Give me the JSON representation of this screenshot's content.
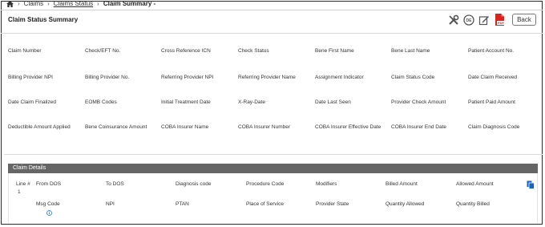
{
  "breadcrumb": {
    "items": [
      "Claims",
      "Claims Status"
    ],
    "current": "Claim Summary -"
  },
  "page": {
    "title": "Claim Status Summary",
    "back_label": "Back"
  },
  "toolbar": {
    "icons": [
      "tools-icon",
      "dde-icon",
      "edit-icon",
      "pdf-icon"
    ]
  },
  "summary_fields": [
    [
      "Claim Number",
      "Check/EFT No.",
      "Cross Reference ICN",
      "Check Status",
      "Bene First Name",
      "Bene Last Name",
      "Patient Account No."
    ],
    [
      "Billing Provider NPI",
      "Billing Provider No.",
      "Referring Provider NPI",
      "Referring Provider Name",
      "Assignment Indicator",
      "Claim Status Code",
      "Date Claim Received"
    ],
    [
      "Date Claim Finalized",
      "EOMB Codes",
      "Initial Treatment Date",
      "X-Ray-Date",
      "Date Last Seen",
      "Provider Check Amount",
      "Patient Paid Amount"
    ],
    [
      "Deductible Amount Applied",
      "Bene Coinsurance Amount",
      "COBA Insurer Name",
      "COBA Insurer Number",
      "COBA Insurer Effective Date",
      "COBA Insurer End Date",
      "Claim Diagnosis Code"
    ]
  ],
  "claim_details": {
    "title": "Claim Details",
    "line_label": "Line #",
    "line_value": "1",
    "row1": [
      "From DOS",
      "To DOS",
      "Diagnosis code",
      "Procedure Code",
      "Modifiers",
      "Billed Amount",
      "Allowed Amount"
    ],
    "row2": [
      "Msg Code",
      "NPI",
      "PTAN",
      "Place of Service",
      "Provider State",
      "Quantity Allowed",
      "Quantity Billed"
    ]
  },
  "colors": {
    "details_bar": "#666666",
    "pdf_red": "#d9231f",
    "copy_blue": "#1565c0",
    "info_blue": "#1e73be"
  }
}
